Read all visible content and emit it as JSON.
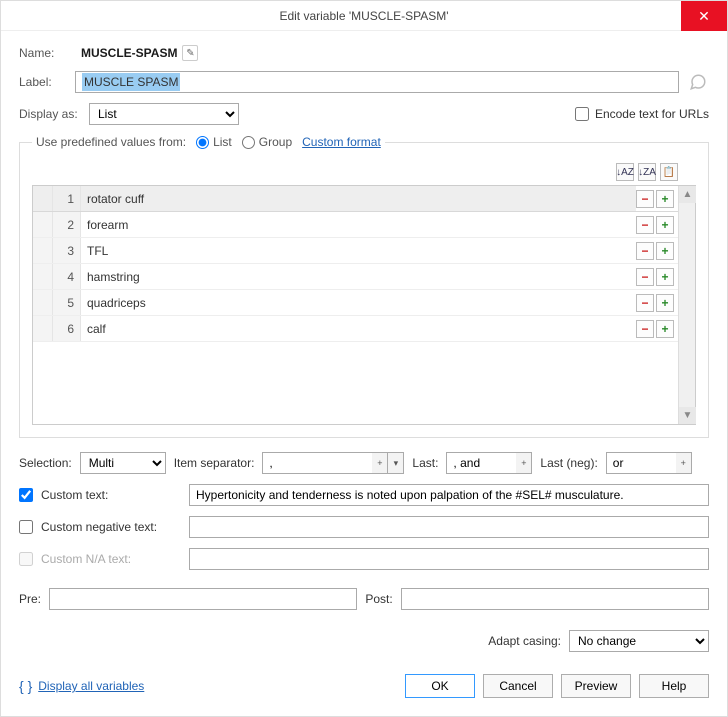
{
  "window": {
    "title": "Edit variable 'MUSCLE-SPASM'"
  },
  "name": {
    "label": "Name:",
    "value": "MUSCLE-SPASM"
  },
  "label_field": {
    "label": "Label:",
    "value": "MUSCLE SPASM"
  },
  "display_as": {
    "label": "Display as:",
    "value": "List"
  },
  "encode": {
    "label": "Encode text for URLs"
  },
  "predef": {
    "legend": "Use predefined values from:",
    "list": "List",
    "group": "Group",
    "custom_format": "Custom format"
  },
  "list_items": [
    {
      "n": "1",
      "text": "rotator cuff"
    },
    {
      "n": "2",
      "text": "forearm"
    },
    {
      "n": "3",
      "text": "TFL"
    },
    {
      "n": "4",
      "text": "hamstring"
    },
    {
      "n": "5",
      "text": "quadriceps"
    },
    {
      "n": "6",
      "text": "calf"
    }
  ],
  "selection": {
    "label": "Selection:",
    "value": "Multi",
    "item_sep_label": "Item separator:",
    "item_sep": ",",
    "last_label": "Last:",
    "last": ", and",
    "last_neg_label": "Last (neg):",
    "last_neg": "or"
  },
  "custom_text": {
    "checkbox_label": "Custom text:",
    "value": "Hypertonicity and tenderness is noted upon palpation of the #SEL# musculature."
  },
  "custom_neg": {
    "checkbox_label": "Custom negative text:",
    "value": ""
  },
  "custom_na": {
    "checkbox_label": "Custom N/A text:",
    "value": ""
  },
  "pre": {
    "label": "Pre:",
    "value": ""
  },
  "post": {
    "label": "Post:",
    "value": ""
  },
  "adapt": {
    "label": "Adapt casing:",
    "value": "No change"
  },
  "footer": {
    "display_all": "Display all variables",
    "ok": "OK",
    "cancel": "Cancel",
    "preview": "Preview",
    "help": "Help"
  }
}
